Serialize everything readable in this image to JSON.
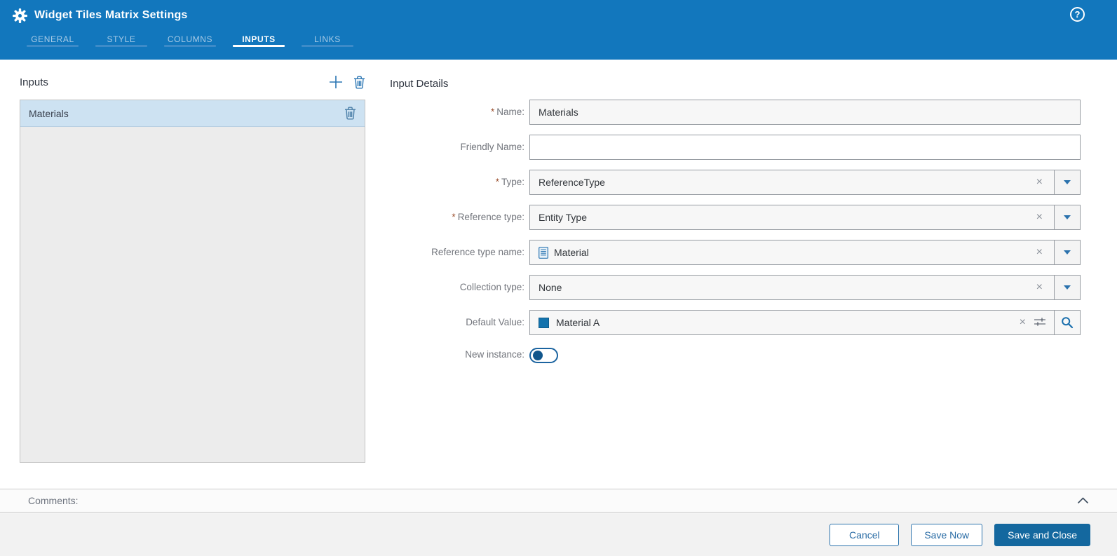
{
  "header": {
    "title": "Widget Tiles Matrix Settings",
    "help_label": "?",
    "tabs": [
      {
        "label": "GENERAL",
        "active": false
      },
      {
        "label": "STYLE",
        "active": false
      },
      {
        "label": "COLUMNS",
        "active": false
      },
      {
        "label": "INPUTS",
        "active": true
      },
      {
        "label": "LINKS",
        "active": false
      }
    ],
    "active_tab": "INPUTS"
  },
  "inputs_panel": {
    "title": "Inputs",
    "items": [
      {
        "label": "Materials",
        "selected": true
      }
    ]
  },
  "details": {
    "title": "Input Details",
    "required_marker": "*",
    "clear_glyph": "×",
    "fields": {
      "name": {
        "label": "Name:",
        "required": true,
        "value": "Materials"
      },
      "friendly_name": {
        "label": "Friendly Name:",
        "required": false,
        "value": "",
        "placeholder": ""
      },
      "type": {
        "label": "Type:",
        "required": true,
        "value": "ReferenceType"
      },
      "reference_type": {
        "label": "Reference type:",
        "required": true,
        "value": "Entity Type"
      },
      "reference_type_name": {
        "label": "Reference type name:",
        "required": false,
        "value": "Material",
        "icon": "document-icon"
      },
      "collection_type": {
        "label": "Collection type:",
        "required": false,
        "value": "None"
      },
      "default_value": {
        "label": "Default Value:",
        "required": false,
        "value": "Material A",
        "icon": "material-swatch",
        "swatch_color": "#1473ad"
      },
      "new_instance": {
        "label": "New instance:",
        "required": false,
        "toggle_on": false
      }
    }
  },
  "comments": {
    "label": "Comments:",
    "collapsed": false
  },
  "footer": {
    "cancel_label": "Cancel",
    "save_now_label": "Save Now",
    "save_and_close_label": "Save and Close"
  },
  "colors": {
    "header_bg": "#1277bd",
    "active_tab_underline": "#ffffff",
    "inactive_tab_underline": "#3d8bc8",
    "selected_row_bg": "#cde2f2",
    "list_bg": "#ececec",
    "accent_blue": "#2b72ad",
    "primary_button_bg": "#14689f",
    "required_marker_color": "#9c5130",
    "footer_bg": "#f2f2f2"
  }
}
